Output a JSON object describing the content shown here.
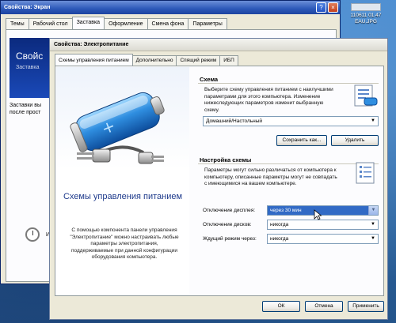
{
  "desktop": {
    "file_name": "110611 01.47",
    "file_ext": "EAU.JPG"
  },
  "display_window": {
    "title": "Свойства: Экран",
    "tabs": [
      "Темы",
      "Рабочий стол",
      "Заставка",
      "Оформление",
      "Смена фона",
      "Параметры"
    ],
    "active_tab": "Заставка",
    "preview_big": "Свойс",
    "preview_small": "Заставка",
    "text_lines": [
      "Заставки вы",
      "после прост"
    ],
    "bottom_label": "И"
  },
  "power_window": {
    "title": "Свойства: Электропитание",
    "tabs": [
      "Схемы управления питанием",
      "Дополнительно",
      "Спящий режим",
      "ИБП"
    ],
    "active_tab": "Схемы управления питанием",
    "panel_heading": "Схемы управления питанием",
    "panel_desc": "С помощью компонента панели управления \"Электропитание\" можно настраивать любые параметры электропитания, поддерживаемые при данной конфигурации оборудования компьютера.",
    "scheme_group": {
      "title": "Схема",
      "text": "Выберите схему управления питанием с наилучшими параметрами для этого компьютера. Изменение нижеследующих параметров изменит выбранную схему.",
      "selected": "Домашний/Настольный",
      "save_as": "Сохранить как...",
      "delete": "Удалить"
    },
    "settings_group": {
      "title": "Настройка схемы",
      "text": "Параметры могут сильно различаться от компьютера к компьютеру, описанные параметры могут не совпадать с имеющимися на вашем компьютере.",
      "display_off_label": "Отключение дисплея:",
      "display_off_value": "через 30 мин",
      "disks_off_label": "Отключение дисков:",
      "disks_off_value": "никогда",
      "standby_label": "Ждущий режим через:",
      "standby_value": "никогда"
    },
    "buttons": {
      "ok": "ОК",
      "cancel": "Отмена",
      "apply": "Применить"
    }
  },
  "colors": {
    "accent_blue": "#316ac5",
    "heading_blue": "#1f3b8c",
    "window_face": "#ece9d8"
  }
}
